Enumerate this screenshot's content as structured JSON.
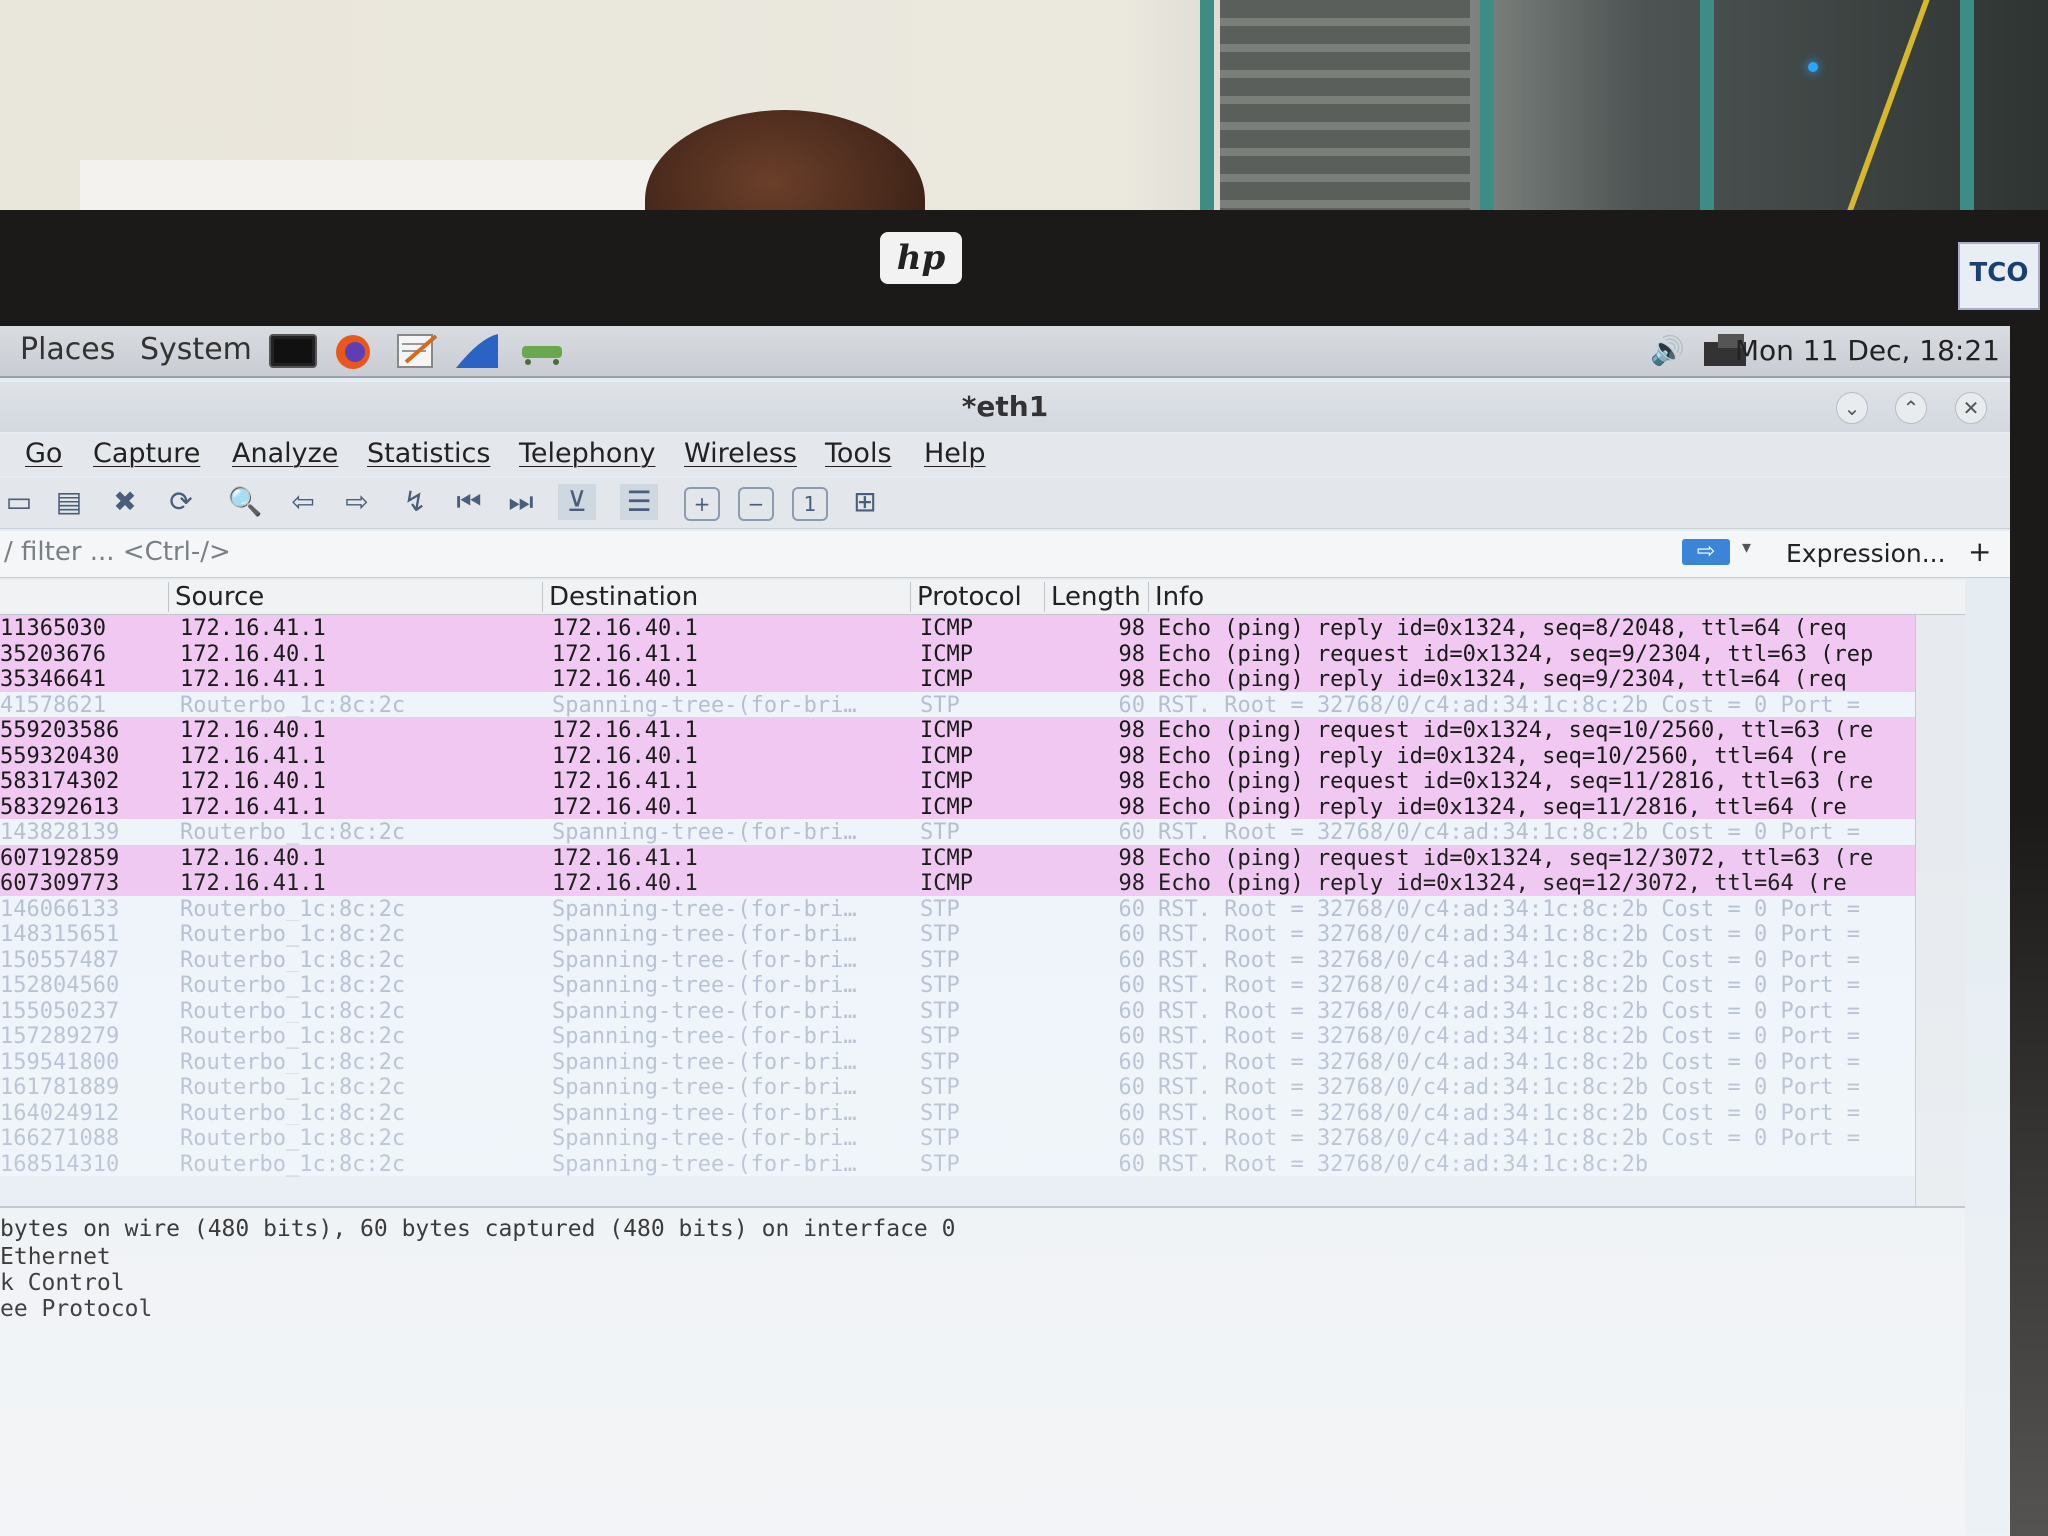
{
  "panel": {
    "menus": [
      "Places",
      "System"
    ],
    "clock": "Mon 11 Dec, 18:21"
  },
  "window": {
    "title": "*eth1"
  },
  "menubar": [
    "Go",
    "Capture",
    "Analyze",
    "Statistics",
    "Telephony",
    "Wireless",
    "Tools",
    "Help"
  ],
  "filter": {
    "placeholder": "/ filter ... <Ctrl-/>",
    "expression_label": "Expression...",
    "plus_label": "+"
  },
  "columns": {
    "source": "Source",
    "destination": "Destination",
    "protocol": "Protocol",
    "length": "Length",
    "info": "Info"
  },
  "packets": [
    {
      "time": "11365030",
      "src": "172.16.41.1",
      "dst": "172.16.40.1",
      "proto": "ICMP",
      "len": "98",
      "info": "Echo (ping) reply   id=0x1324, seq=8/2048, ttl=64 (req",
      "type": "icmp"
    },
    {
      "time": "35203676",
      "src": "172.16.40.1",
      "dst": "172.16.41.1",
      "proto": "ICMP",
      "len": "98",
      "info": "Echo (ping) request  id=0x1324, seq=9/2304, ttl=63 (rep",
      "type": "icmp"
    },
    {
      "time": "35346641",
      "src": "172.16.41.1",
      "dst": "172.16.40.1",
      "proto": "ICMP",
      "len": "98",
      "info": "Echo (ping) reply    id=0x1324, seq=9/2304, ttl=64 (req",
      "type": "icmp"
    },
    {
      "time": "41578621",
      "src": "Routerbo_1c:8c:2c",
      "dst": "Spanning-tree-(for-bri…",
      "proto": "STP",
      "len": "60",
      "info": "RST. Root = 32768/0/c4:ad:34:1c:8c:2b  Cost = 0  Port =",
      "type": "stp"
    },
    {
      "time": "559203586",
      "src": "172.16.40.1",
      "dst": "172.16.41.1",
      "proto": "ICMP",
      "len": "98",
      "info": "Echo (ping) request  id=0x1324, seq=10/2560, ttl=63 (re",
      "type": "icmp"
    },
    {
      "time": "559320430",
      "src": "172.16.41.1",
      "dst": "172.16.40.1",
      "proto": "ICMP",
      "len": "98",
      "info": "Echo (ping) reply    id=0x1324, seq=10/2560, ttl=64 (re",
      "type": "icmp"
    },
    {
      "time": "583174302",
      "src": "172.16.40.1",
      "dst": "172.16.41.1",
      "proto": "ICMP",
      "len": "98",
      "info": "Echo (ping) request  id=0x1324, seq=11/2816, ttl=63 (re",
      "type": "icmp"
    },
    {
      "time": "583292613",
      "src": "172.16.41.1",
      "dst": "172.16.40.1",
      "proto": "ICMP",
      "len": "98",
      "info": "Echo (ping) reply    id=0x1324, seq=11/2816, ttl=64 (re",
      "type": "icmp"
    },
    {
      "time": "143828139",
      "src": "Routerbo_1c:8c:2c",
      "dst": "Spanning-tree-(for-bri…",
      "proto": "STP",
      "len": "60",
      "info": "RST. Root = 32768/0/c4:ad:34:1c:8c:2b  Cost = 0  Port =",
      "type": "stp"
    },
    {
      "time": "607192859",
      "src": "172.16.40.1",
      "dst": "172.16.41.1",
      "proto": "ICMP",
      "len": "98",
      "info": "Echo (ping) request  id=0x1324, seq=12/3072, ttl=63 (re",
      "type": "icmp"
    },
    {
      "time": "607309773",
      "src": "172.16.41.1",
      "dst": "172.16.40.1",
      "proto": "ICMP",
      "len": "98",
      "info": "Echo (ping) reply    id=0x1324, seq=12/3072, ttl=64 (re",
      "type": "icmp"
    },
    {
      "time": "146066133",
      "src": "Routerbo_1c:8c:2c",
      "dst": "Spanning-tree-(for-bri…",
      "proto": "STP",
      "len": "60",
      "info": "RST. Root = 32768/0/c4:ad:34:1c:8c:2b  Cost = 0  Port =",
      "type": "stp"
    },
    {
      "time": "148315651",
      "src": "Routerbo_1c:8c:2c",
      "dst": "Spanning-tree-(for-bri…",
      "proto": "STP",
      "len": "60",
      "info": "RST. Root = 32768/0/c4:ad:34:1c:8c:2b  Cost = 0  Port =",
      "type": "stp"
    },
    {
      "time": "150557487",
      "src": "Routerbo_1c:8c:2c",
      "dst": "Spanning-tree-(for-bri…",
      "proto": "STP",
      "len": "60",
      "info": "RST. Root = 32768/0/c4:ad:34:1c:8c:2b  Cost = 0  Port =",
      "type": "stp"
    },
    {
      "time": "152804560",
      "src": "Routerbo_1c:8c:2c",
      "dst": "Spanning-tree-(for-bri…",
      "proto": "STP",
      "len": "60",
      "info": "RST. Root = 32768/0/c4:ad:34:1c:8c:2b  Cost = 0  Port =",
      "type": "stp"
    },
    {
      "time": "155050237",
      "src": "Routerbo_1c:8c:2c",
      "dst": "Spanning-tree-(for-bri…",
      "proto": "STP",
      "len": "60",
      "info": "RST. Root = 32768/0/c4:ad:34:1c:8c:2b  Cost = 0  Port =",
      "type": "stp"
    },
    {
      "time": "157289279",
      "src": "Routerbo_1c:8c:2c",
      "dst": "Spanning-tree-(for-bri…",
      "proto": "STP",
      "len": "60",
      "info": "RST. Root = 32768/0/c4:ad:34:1c:8c:2b  Cost = 0  Port =",
      "type": "stp"
    },
    {
      "time": "159541800",
      "src": "Routerbo_1c:8c:2c",
      "dst": "Spanning-tree-(for-bri…",
      "proto": "STP",
      "len": "60",
      "info": "RST. Root = 32768/0/c4:ad:34:1c:8c:2b  Cost = 0  Port =",
      "type": "stp"
    },
    {
      "time": "161781889",
      "src": "Routerbo_1c:8c:2c",
      "dst": "Spanning-tree-(for-bri…",
      "proto": "STP",
      "len": "60",
      "info": "RST. Root = 32768/0/c4:ad:34:1c:8c:2b  Cost = 0  Port =",
      "type": "stp"
    },
    {
      "time": "164024912",
      "src": "Routerbo_1c:8c:2c",
      "dst": "Spanning-tree-(for-bri…",
      "proto": "STP",
      "len": "60",
      "info": "RST. Root = 32768/0/c4:ad:34:1c:8c:2b  Cost = 0  Port =",
      "type": "stp"
    },
    {
      "time": "166271088",
      "src": "Routerbo_1c:8c:2c",
      "dst": "Spanning-tree-(for-bri…",
      "proto": "STP",
      "len": "60",
      "info": "RST. Root = 32768/0/c4:ad:34:1c:8c:2b  Cost = 0  Port =",
      "type": "stp"
    },
    {
      "time": "168514310",
      "src": "Routerbo_1c:8c:2c",
      "dst": "Spanning-tree-(for-bri…",
      "proto": "STP",
      "len": "60",
      "info": "RST. Root = 32768/0/c4:ad:34:1c:8c:2b",
      "type": "stp"
    }
  ],
  "details": [
    " bytes on wire (480 bits), 60 bytes captured (480 bits) on interface 0",
    "Ethernet",
    "k Control",
    "ee Protocol"
  ],
  "colors": {
    "icmp_row": "#f0c8f2",
    "stp_row": "#eef4fa",
    "filter_apply": "#3b84d6"
  }
}
